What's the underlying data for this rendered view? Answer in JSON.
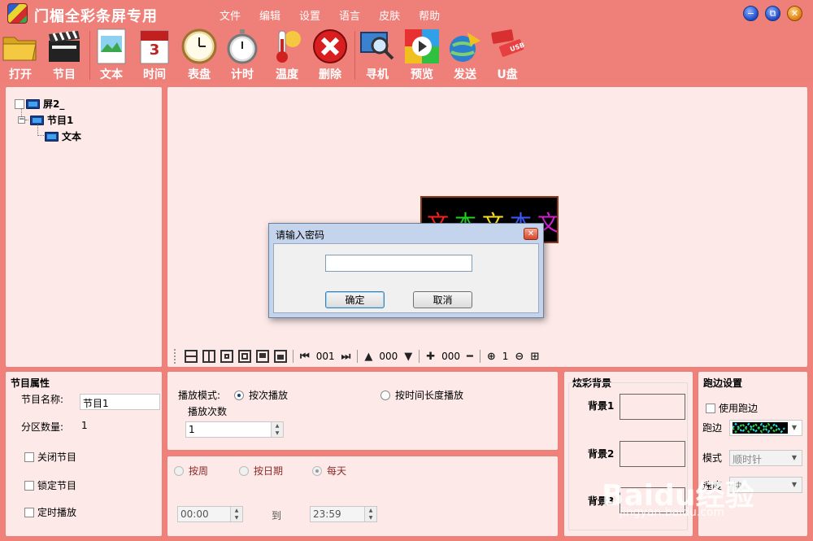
{
  "app": {
    "title": "门楣全彩条屏专用"
  },
  "menu": [
    "文件",
    "编辑",
    "设置",
    "语言",
    "皮肤",
    "帮助"
  ],
  "window_buttons": {
    "minimize": "−",
    "restore": "⧉",
    "close": "✕"
  },
  "toolbar": [
    {
      "label": "打开",
      "icon": "folder-open-icon"
    },
    {
      "label": "节目",
      "icon": "clapperboard-icon"
    },
    {
      "label": "文本",
      "icon": "document-image-icon"
    },
    {
      "label": "时间",
      "icon": "calendar-icon"
    },
    {
      "label": "表盘",
      "icon": "clock-icon"
    },
    {
      "label": "计时",
      "icon": "stopwatch-icon"
    },
    {
      "label": "温度",
      "icon": "thermometer-icon"
    },
    {
      "label": "删除",
      "icon": "delete-icon"
    },
    {
      "label": "寻机",
      "icon": "monitor-search-icon"
    },
    {
      "label": "预览",
      "icon": "play-icon"
    },
    {
      "label": "发送",
      "icon": "globe-send-icon"
    },
    {
      "label": "U盘",
      "icon": "usb-icon"
    }
  ],
  "tree": {
    "screen": "屏2_",
    "program": "节目1",
    "text": "文本"
  },
  "preview_toolbar": {
    "page": "001",
    "up_value": "000",
    "plus_value": "000",
    "zoom": "1"
  },
  "text_preview": {
    "chars": [
      "文",
      "本",
      "文",
      "本",
      "文"
    ],
    "colors": [
      "#ff2020",
      "#20d020",
      "#ffe020",
      "#3a5bff",
      "#d020d0"
    ]
  },
  "dialog": {
    "title": "请输入密码",
    "close": "✕",
    "password_value": "",
    "ok_label": "确定",
    "cancel_label": "取消"
  },
  "program_props": {
    "heading": "节目属性",
    "name_label": "节目名称:",
    "name_value": "节目1",
    "area_count_label": "分区数量:",
    "area_count_value": "1",
    "close_program": "关闭节目",
    "lock_program": "锁定节目",
    "timed_play": "定时播放"
  },
  "play_mode": {
    "label": "播放模式:",
    "by_count": "按次播放",
    "by_duration": "按时间长度播放",
    "count_label": "播放次数",
    "count_value": "1"
  },
  "schedule": {
    "by_week": "按周",
    "by_date": "按日期",
    "daily": "每天",
    "start_time": "00:00",
    "to": "到",
    "end_time": "23:59"
  },
  "background": {
    "heading": "炫彩背景",
    "bg1": "背景1",
    "bg2": "背景2",
    "bg3": "背景3"
  },
  "border": {
    "heading": "跑边设置",
    "use_border": "使用跑边",
    "border_label": "跑边",
    "mode_label": "模式",
    "mode_value": "顺时针",
    "speed_label": "速度",
    "speed_value": "快"
  },
  "watermark": {
    "brand": "Baidu经验",
    "url": "jingyan.baidu.com"
  },
  "colors": {
    "accent": "#ef7f79",
    "panel": "#fce9e8",
    "dialog": "#c4d4ec"
  }
}
